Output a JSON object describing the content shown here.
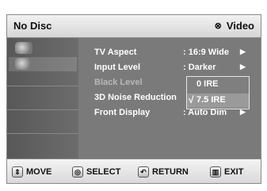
{
  "header": {
    "disc_status": "No Disc",
    "mode_label": "Video"
  },
  "sidebar": {
    "tabs": [
      "",
      ""
    ]
  },
  "menu": {
    "items": [
      {
        "label": "TV Aspect",
        "value": ": 16:9 Wide",
        "arrow": "▶"
      },
      {
        "label": "Input Level",
        "value": ": Darker",
        "arrow": "▶"
      },
      {
        "label": "Black Level",
        "value": "",
        "arrow": ""
      },
      {
        "label": "3D Noise Reduction",
        "value": "",
        "arrow": ""
      },
      {
        "label": "Front Display",
        "value": ": Auto Dim",
        "arrow": "▶"
      }
    ]
  },
  "dropdown": {
    "options": [
      "0 IRE",
      "7.5 IRE"
    ],
    "selected": "7.5 IRE",
    "check": "√"
  },
  "footer": {
    "buttons": [
      {
        "label": "MOVE"
      },
      {
        "label": "SELECT"
      },
      {
        "label": "RETURN"
      },
      {
        "label": "EXIT"
      }
    ]
  }
}
